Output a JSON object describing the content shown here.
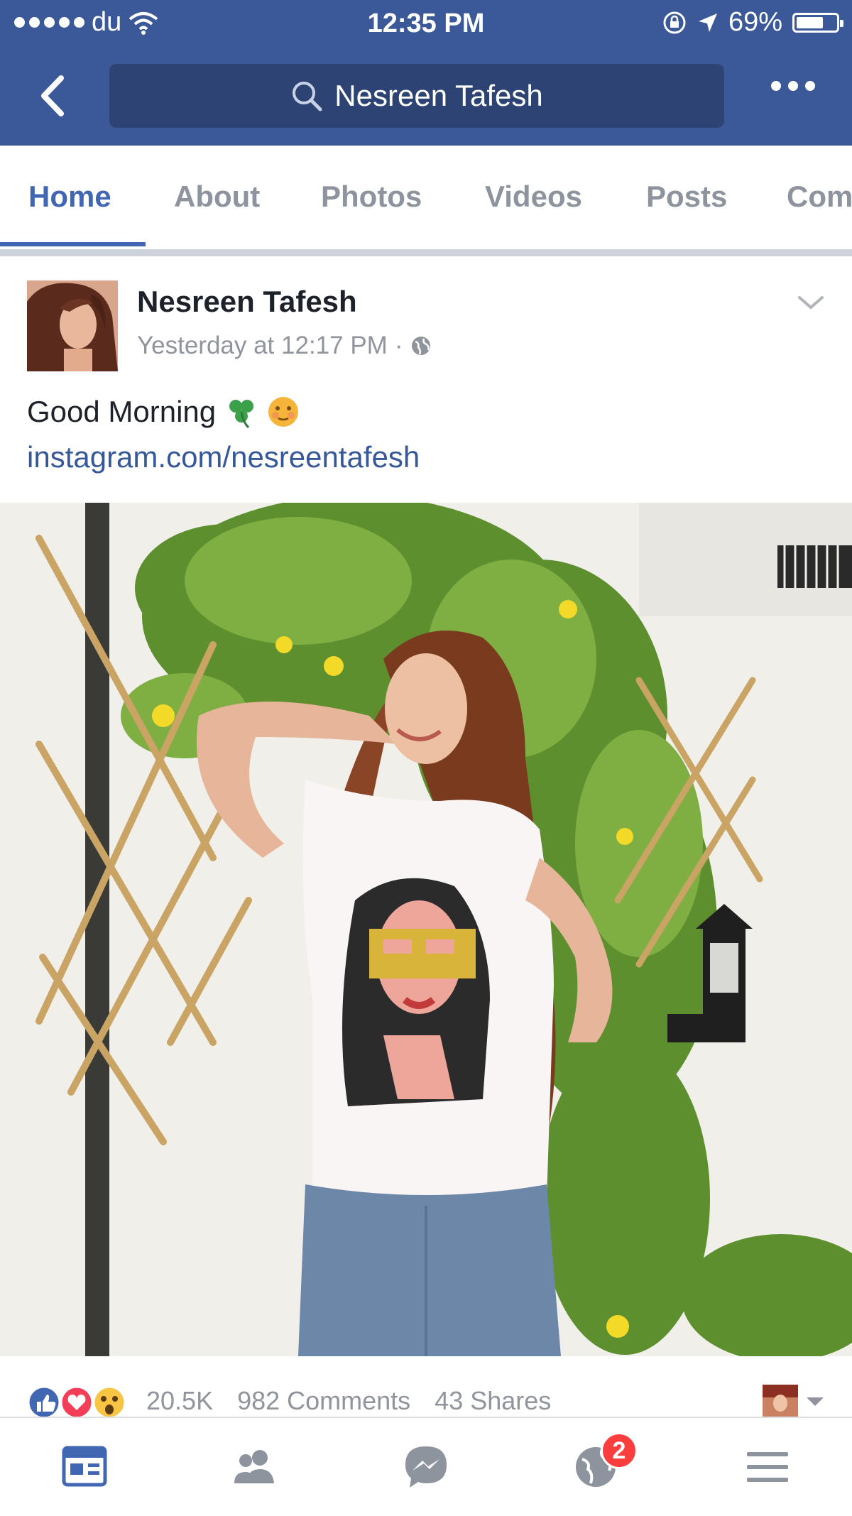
{
  "status_bar": {
    "carrier": "du",
    "time": "12:35 PM",
    "battery": "69%",
    "battery_level": 0.69
  },
  "nav": {
    "search_text": "Nesreen Tafesh"
  },
  "tabs": [
    {
      "label": "Home",
      "active": true
    },
    {
      "label": "About",
      "active": false
    },
    {
      "label": "Photos",
      "active": false
    },
    {
      "label": "Videos",
      "active": false
    },
    {
      "label": "Posts",
      "active": false
    },
    {
      "label": "Com",
      "active": false
    }
  ],
  "post": {
    "author": "Nesreen Tafesh",
    "timestamp": "Yesterday at 12:17 PM",
    "separator": "·",
    "text": "Good Morning",
    "emojis": [
      "☘️",
      "😶"
    ],
    "link": "instagram.com/nesreentafesh"
  },
  "engagement": {
    "reactions_count": "20.5K",
    "comments": "982 Comments",
    "shares": "43 Shares"
  },
  "bottom_nav": {
    "notifications_badge": "2"
  },
  "colors": {
    "brand": "#3b5998",
    "active_tab": "#4267b2",
    "link": "#365899",
    "badge": "#fa3e3e"
  }
}
